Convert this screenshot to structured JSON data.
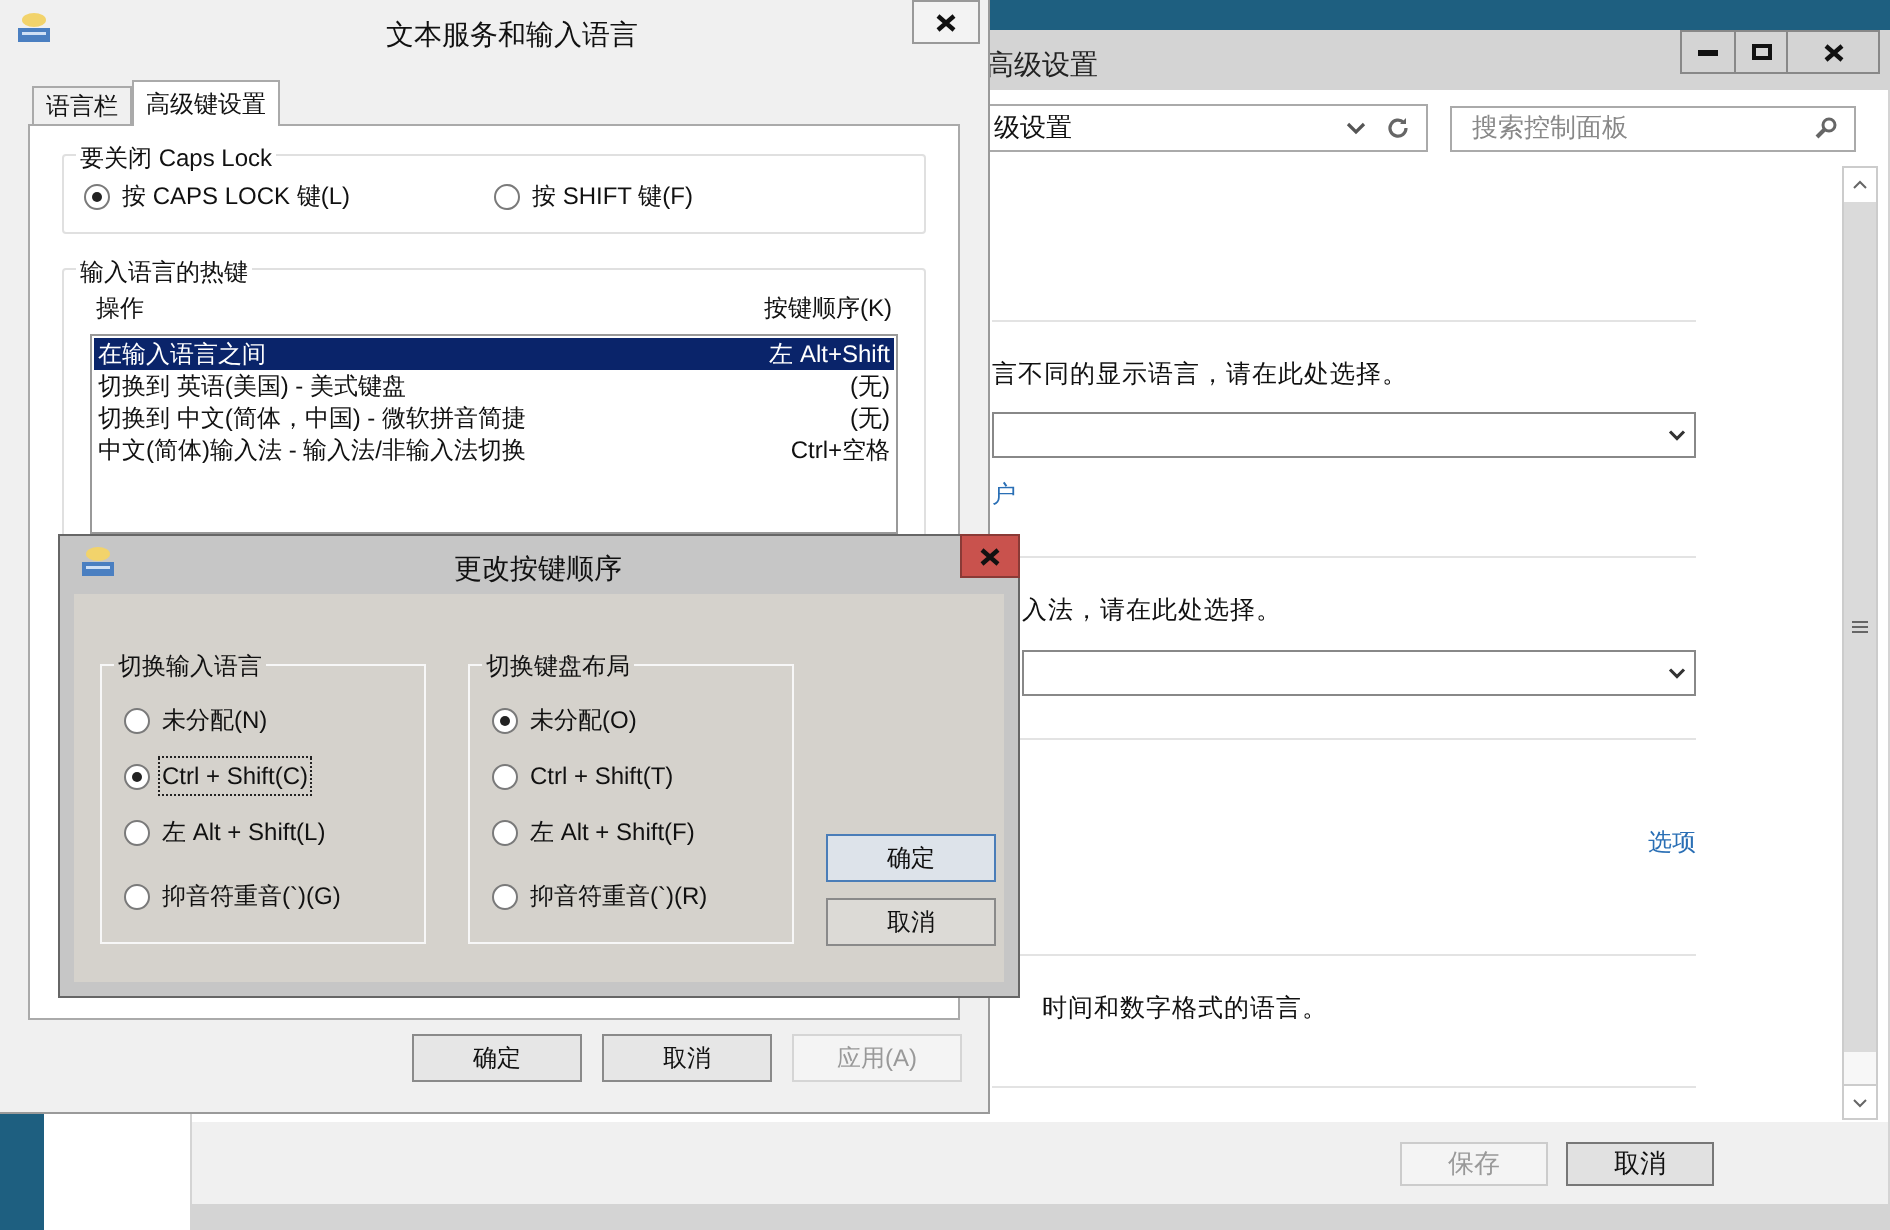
{
  "back_window": {
    "title": "高级设置",
    "address": "级设置",
    "search": {
      "placeholder": "搜索控制面板"
    },
    "display_text": "言不同的显示语言，请在此处选择。",
    "account_link": "户",
    "input_text": "入法，请在此处选择。",
    "options_link": "选项",
    "format_text": "时间和数字格式的语言。",
    "buttons": [
      {
        "label": "保存",
        "disabled": true
      },
      {
        "label": "取消",
        "disabled": false
      }
    ]
  },
  "main_window": {
    "title": "文本服务和输入语言",
    "tabs": [
      {
        "label": "语言栏",
        "selected": false
      },
      {
        "label": "高级键设置",
        "selected": true
      }
    ],
    "caps_group": {
      "title": "要关闭 Caps Lock",
      "options": [
        {
          "label": "按 CAPS LOCK 键(L)",
          "selected": true
        },
        {
          "label": "按 SHIFT 键(F)",
          "selected": false
        }
      ]
    },
    "hotkeys": {
      "title": "输入语言的热键",
      "columns": [
        "操作",
        "按键顺序(K)"
      ],
      "rows": [
        {
          "action": "在输入语言之间",
          "keys": "左 Alt+Shift",
          "selected": true
        },
        {
          "action": "切换到 英语(美国) - 美式键盘",
          "keys": "(无)",
          "selected": false
        },
        {
          "action": "切换到 中文(简体，中国) - 微软拼音简捷",
          "keys": "(无)",
          "selected": false
        },
        {
          "action": "中文(简体)输入法 - 输入法/非输入法切换",
          "keys": "Ctrl+空格",
          "selected": false
        }
      ]
    },
    "buttons": [
      {
        "label": "确定",
        "disabled": false
      },
      {
        "label": "取消",
        "disabled": false
      },
      {
        "label": "应用(A)",
        "disabled": true
      }
    ]
  },
  "dialog": {
    "title": "更改按键顺序",
    "groups": [
      {
        "title": "切换输入语言",
        "options": [
          {
            "label": "未分配(N)",
            "selected": false,
            "focused": false
          },
          {
            "label": "Ctrl + Shift(C)",
            "selected": true,
            "focused": true
          },
          {
            "label": "左 Alt + Shift(L)",
            "selected": false,
            "focused": false
          },
          {
            "label": "抑音符重音(`)(G)",
            "selected": false,
            "focused": false
          }
        ]
      },
      {
        "title": "切换键盘布局",
        "options": [
          {
            "label": "未分配(O)",
            "selected": true,
            "focused": false
          },
          {
            "label": "Ctrl + Shift(T)",
            "selected": false,
            "focused": false
          },
          {
            "label": "左 Alt + Shift(F)",
            "selected": false,
            "focused": false
          },
          {
            "label": "抑音符重音(`)(R)",
            "selected": false,
            "focused": false
          }
        ]
      }
    ],
    "buttons": [
      {
        "label": "确定",
        "default": true
      },
      {
        "label": "取消",
        "default": false
      }
    ]
  }
}
